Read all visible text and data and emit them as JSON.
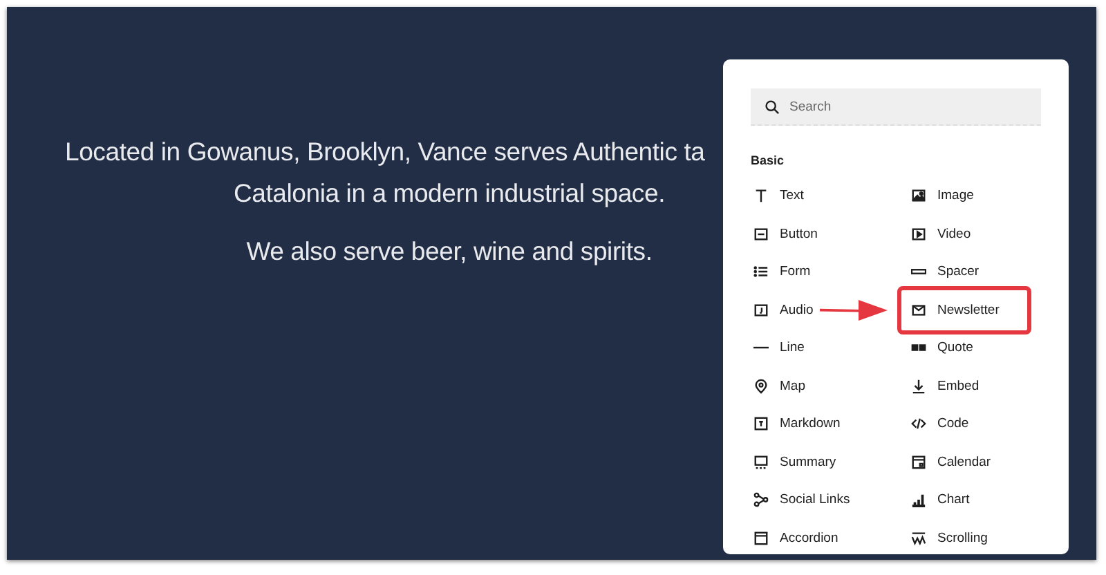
{
  "hero": {
    "lines": [
      "Located in Gowanus, Brooklyn, Vance serves Authentic ta",
      "Catalonia in a modern industrial space.",
      "We also serve beer, wine and spirits."
    ]
  },
  "block_picker": {
    "search": {
      "placeholder": "Search"
    },
    "section": "Basic",
    "items": [
      {
        "label": "Text",
        "highlighted": false
      },
      {
        "label": "Image",
        "highlighted": false
      },
      {
        "label": "Button",
        "highlighted": false
      },
      {
        "label": "Video",
        "highlighted": false
      },
      {
        "label": "Form",
        "highlighted": false
      },
      {
        "label": "Spacer",
        "highlighted": false
      },
      {
        "label": "Audio",
        "highlighted": false
      },
      {
        "label": "Newsletter",
        "highlighted": true
      },
      {
        "label": "Line",
        "highlighted": false
      },
      {
        "label": "Quote",
        "highlighted": false
      },
      {
        "label": "Map",
        "highlighted": false
      },
      {
        "label": "Embed",
        "highlighted": false
      },
      {
        "label": "Markdown",
        "highlighted": false
      },
      {
        "label": "Code",
        "highlighted": false
      },
      {
        "label": "Summary",
        "highlighted": false
      },
      {
        "label": "Calendar",
        "highlighted": false
      },
      {
        "label": "Social Links",
        "highlighted": false
      },
      {
        "label": "Chart",
        "highlighted": false
      },
      {
        "label": "Accordion",
        "highlighted": false
      },
      {
        "label": "Scrolling",
        "highlighted": false
      }
    ]
  }
}
